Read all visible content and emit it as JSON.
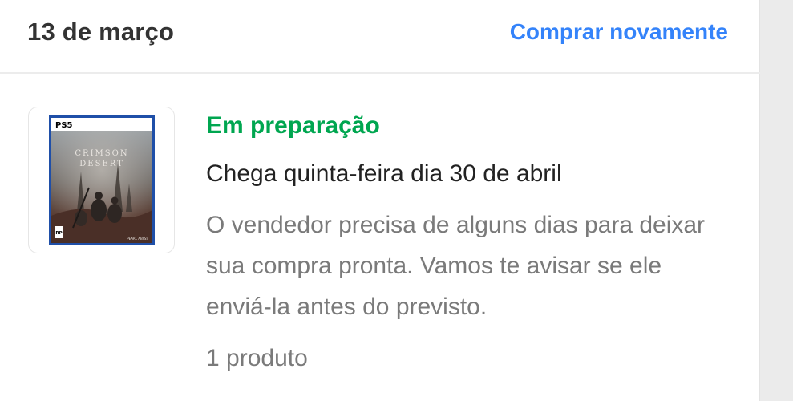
{
  "order": {
    "date": "13 de março",
    "rebuy_label": "Comprar novamente"
  },
  "item": {
    "status": "Em preparação",
    "arrival": "Chega quinta-feira dia 30 de abril",
    "description": "O vendedor precisa de alguns dias para deixar sua compra pronta. Vamos te avisar se ele enviá-la antes do previsto.",
    "product_count": "1 produto",
    "cover": {
      "platform": "PS5",
      "title_line1": "CRIMSON",
      "title_line2": "DESERT",
      "rating": "RP",
      "publisher": "PEARL ABYSS"
    }
  },
  "colors": {
    "link": "#3483fa",
    "status": "#00a650",
    "text": "#333333",
    "muted": "#7a7a7a"
  }
}
